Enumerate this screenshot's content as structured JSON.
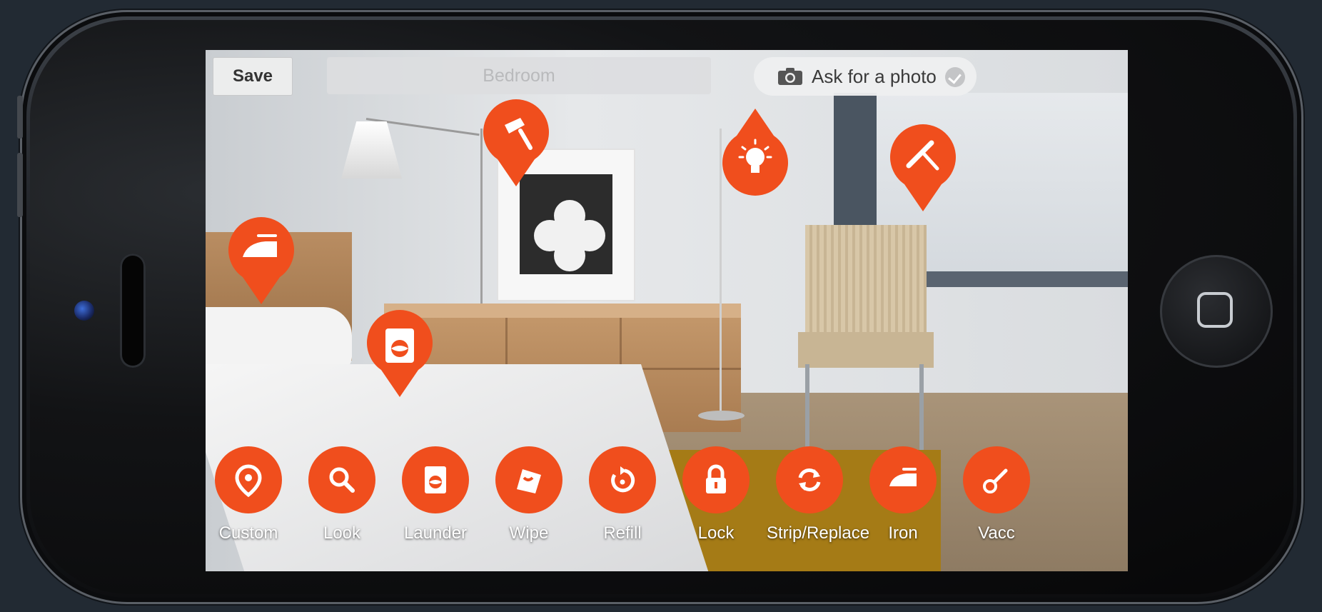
{
  "topbar": {
    "save_label": "Save",
    "room_name": "Bedroom",
    "ask_photo_label": "Ask for a photo"
  },
  "accent_color": "#f04e1d",
  "map_pins": [
    {
      "icon": "duster-icon"
    },
    {
      "icon": "lightbulb-icon"
    },
    {
      "icon": "squeegee-icon"
    },
    {
      "icon": "iron-icon"
    },
    {
      "icon": "washing-machine-icon"
    }
  ],
  "toolbar": {
    "items": [
      {
        "label": "Custom",
        "icon": "custom-pin-icon"
      },
      {
        "label": "Look",
        "icon": "search-icon"
      },
      {
        "label": "Launder",
        "icon": "washing-machine-icon"
      },
      {
        "label": "Wipe",
        "icon": "wipe-icon"
      },
      {
        "label": "Refill",
        "icon": "refill-icon"
      },
      {
        "label": "Lock",
        "icon": "lock-icon"
      },
      {
        "label": "Strip/Replace",
        "icon": "strip-replace-icon"
      },
      {
        "label": "Iron",
        "icon": "iron-icon"
      },
      {
        "label": "Vacc",
        "icon": "vacuum-icon"
      }
    ]
  }
}
